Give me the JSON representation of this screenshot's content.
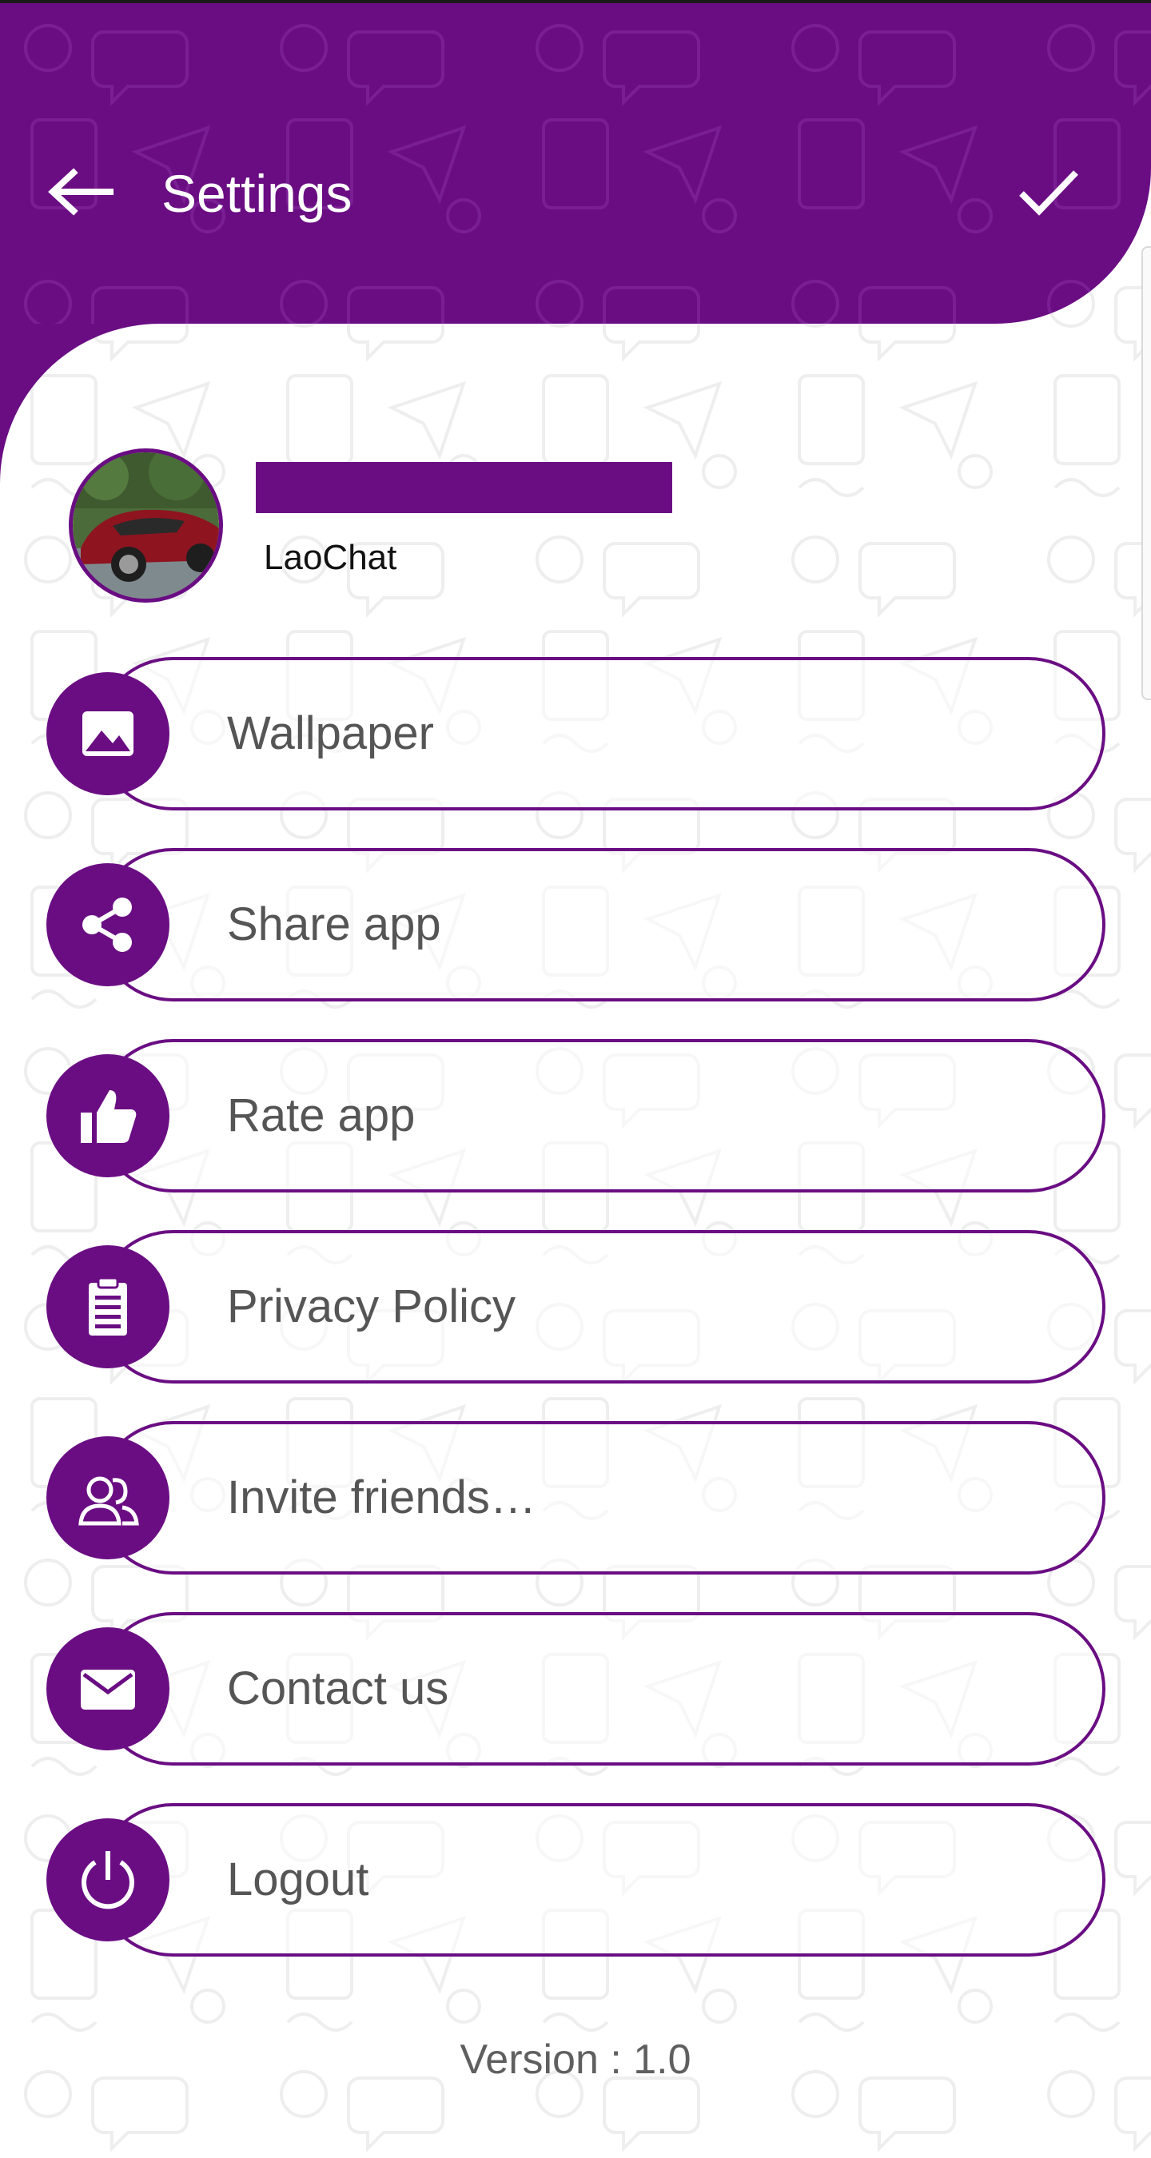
{
  "colors": {
    "accent": "#6a0d83",
    "text": "#555555",
    "background": "#ffffff"
  },
  "header": {
    "title": "Settings",
    "back_icon": "arrow-left-icon",
    "confirm_icon": "checkmark-icon"
  },
  "profile": {
    "app_name": "LaoChat",
    "avatar": "red car photo"
  },
  "menu": [
    {
      "label": "Wallpaper",
      "icon": "image-icon"
    },
    {
      "label": "Share app",
      "icon": "share-icon"
    },
    {
      "label": "Rate app",
      "icon": "thumbs-up-icon"
    },
    {
      "label": "Privacy Policy",
      "icon": "clipboard-icon"
    },
    {
      "label": "Invite friends…",
      "icon": "people-icon"
    },
    {
      "label": "Contact us",
      "icon": "envelope-icon"
    },
    {
      "label": "Logout",
      "icon": "power-icon"
    }
  ],
  "footer": {
    "version": "Version : 1.0"
  }
}
